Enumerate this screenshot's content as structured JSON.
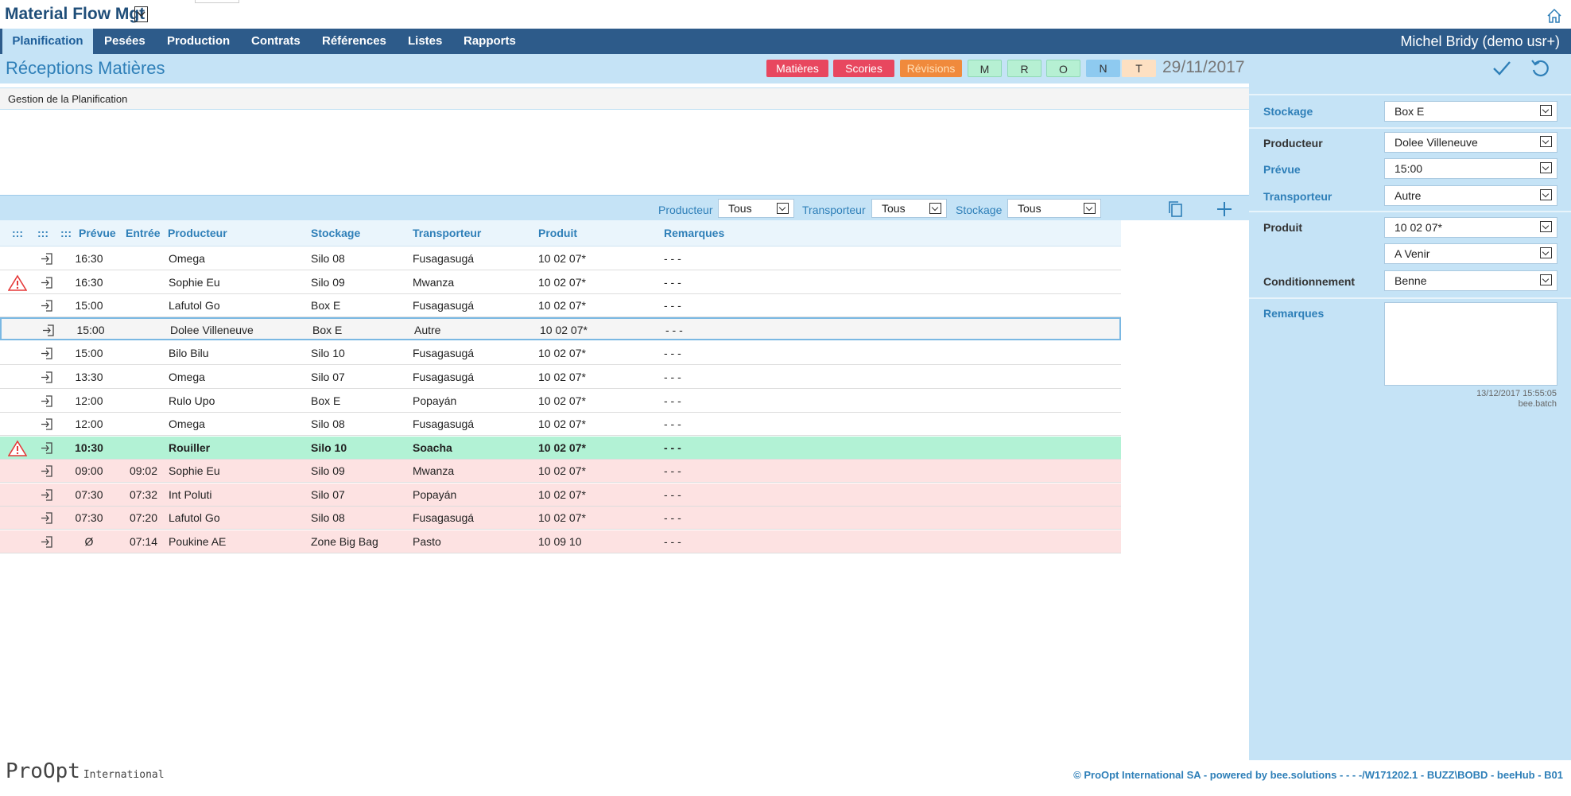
{
  "app": {
    "title": "Material Flow Mgt"
  },
  "nav": {
    "items": [
      {
        "label": "Planification",
        "active": true
      },
      {
        "label": "Pesées"
      },
      {
        "label": "Production"
      },
      {
        "label": "Contrats"
      },
      {
        "label": "Références"
      },
      {
        "label": "Listes"
      },
      {
        "label": "Rapports"
      }
    ],
    "user": "Michel Bridy (demo usr+)"
  },
  "header": {
    "title": "Réceptions Matières",
    "badges": [
      {
        "label": "Matières",
        "bg": "#e8475f",
        "fg": "#ffffff"
      },
      {
        "label": "Scories",
        "bg": "#e8475f",
        "fg": "#ffffff"
      },
      {
        "label": "Révisions",
        "bg": "#f08a3c",
        "fg": "#ffe0b8"
      },
      {
        "label": "M",
        "bg": "#b6f0d3",
        "fg": "#333333"
      },
      {
        "label": "R",
        "bg": "#b6f0d3",
        "fg": "#333333"
      },
      {
        "label": "O",
        "bg": "#b6f0d3",
        "fg": "#333333"
      },
      {
        "label": "N",
        "bg": "#8ecaf0",
        "fg": "#333333"
      },
      {
        "label": "T",
        "bg": "#fde0c2",
        "fg": "#333333"
      }
    ],
    "date": "29/11/2017"
  },
  "gestion": {
    "label": "Gestion de la Planification"
  },
  "filters": {
    "producteur": {
      "label": "Producteur",
      "value": "Tous"
    },
    "transporteur": {
      "label": "Transporteur",
      "value": "Tous"
    },
    "stockage": {
      "label": "Stockage",
      "value": "Tous"
    }
  },
  "table": {
    "headers": {
      "grip1": ":::",
      "grip2": ":::",
      "grip3": ":::",
      "prevue": "Prévue",
      "entree": "Entrée",
      "producteur": "Producteur",
      "stockage": "Stockage",
      "transporteur": "Transporteur",
      "produit": "Produit",
      "remarques": "Remarques"
    },
    "rows": [
      {
        "prevue": "16:30",
        "entree": "",
        "producteur": "Omega",
        "stockage": "Silo 08",
        "transporteur": "Fusagasugá",
        "produit": "10 02 07*",
        "remarques": "- - -",
        "warn": false,
        "state": "normal"
      },
      {
        "prevue": "16:30",
        "entree": "",
        "producteur": "Sophie Eu",
        "stockage": "Silo 09",
        "transporteur": "Mwanza",
        "produit": "10 02 07*",
        "remarques": "- - -",
        "warn": true,
        "state": "normal"
      },
      {
        "prevue": "15:00",
        "entree": "",
        "producteur": "Lafutol Go",
        "stockage": "Box E",
        "transporteur": "Fusagasugá",
        "produit": "10 02 07*",
        "remarques": "- - -",
        "warn": false,
        "state": "normal"
      },
      {
        "prevue": "15:00",
        "entree": "",
        "producteur": "Dolee Villeneuve",
        "stockage": "Box E",
        "transporteur": "Autre",
        "produit": "10 02 07*",
        "remarques": "- - -",
        "warn": false,
        "state": "selected"
      },
      {
        "prevue": "15:00",
        "entree": "",
        "producteur": "Bilo Bilu",
        "stockage": "Silo 10",
        "transporteur": "Fusagasugá",
        "produit": "10 02 07*",
        "remarques": "- - -",
        "warn": false,
        "state": "normal"
      },
      {
        "prevue": "13:30",
        "entree": "",
        "producteur": "Omega",
        "stockage": "Silo 07",
        "transporteur": "Fusagasugá",
        "produit": "10 02 07*",
        "remarques": "- - -",
        "warn": false,
        "state": "normal"
      },
      {
        "prevue": "12:00",
        "entree": "",
        "producteur": "Rulo Upo",
        "stockage": "Box E",
        "transporteur": "Popayán",
        "produit": "10 02 07*",
        "remarques": "- - -",
        "warn": false,
        "state": "normal"
      },
      {
        "prevue": "12:00",
        "entree": "",
        "producteur": "Omega",
        "stockage": "Silo 08",
        "transporteur": "Fusagasugá",
        "produit": "10 02 07*",
        "remarques": "- - -",
        "warn": false,
        "state": "normal"
      },
      {
        "prevue": "10:30",
        "entree": "",
        "producteur": "Rouiller",
        "stockage": "Silo 10",
        "transporteur": "Soacha",
        "produit": "10 02 07*",
        "remarques": "- - -",
        "warn": true,
        "state": "green"
      },
      {
        "prevue": "09:00",
        "entree": "09:02",
        "producteur": "Sophie Eu",
        "stockage": "Silo 09",
        "transporteur": "Mwanza",
        "produit": "10 02 07*",
        "remarques": "- - -",
        "warn": false,
        "state": "red"
      },
      {
        "prevue": "07:30",
        "entree": "07:32",
        "producteur": "Int Poluti",
        "stockage": "Silo 07",
        "transporteur": "Popayán",
        "produit": "10 02 07*",
        "remarques": "- - -",
        "warn": false,
        "state": "red"
      },
      {
        "prevue": "07:30",
        "entree": "07:20",
        "producteur": "Lafutol Go",
        "stockage": "Silo 08",
        "transporteur": "Fusagasugá",
        "produit": "10 02 07*",
        "remarques": "- - -",
        "warn": false,
        "state": "red"
      },
      {
        "prevue": "Ø",
        "entree": "07:14",
        "producteur": "Poukine AE",
        "stockage": "Zone Big Bag",
        "transporteur": "Pasto",
        "produit": "10 09 10",
        "remarques": "- - -",
        "warn": false,
        "state": "red"
      }
    ]
  },
  "form": {
    "stockage": {
      "label": "Stockage",
      "value": "Box E"
    },
    "producteur": {
      "label": "Producteur",
      "value": "Dolee Villeneuve"
    },
    "prevue": {
      "label": "Prévue",
      "value": "15:00"
    },
    "transporteur": {
      "label": "Transporteur",
      "value": "Autre"
    },
    "produit": {
      "label": "Produit",
      "value": "10 02 07*"
    },
    "statut": {
      "value": "A Venir"
    },
    "conditionnement": {
      "label": "Conditionnement",
      "value": "Benne"
    },
    "remarques": {
      "label": "Remarques",
      "value": ""
    },
    "timestamp": "13/12/2017 15:55:05",
    "user": "bee.batch"
  },
  "footer": {
    "logo_main": "ProOpt",
    "logo_sub": "International",
    "text": "© ProOpt International SA - powered by bee.solutions - - - -/W171202.1 - BUZZ\\BOBD - beeHub - B01"
  },
  "icons": {
    "home": "home-icon",
    "confirm": "check-icon",
    "undo": "undo-icon",
    "copy": "copy-icon",
    "add": "plus-icon",
    "enter": "enter-icon",
    "warning": "warning-icon"
  }
}
